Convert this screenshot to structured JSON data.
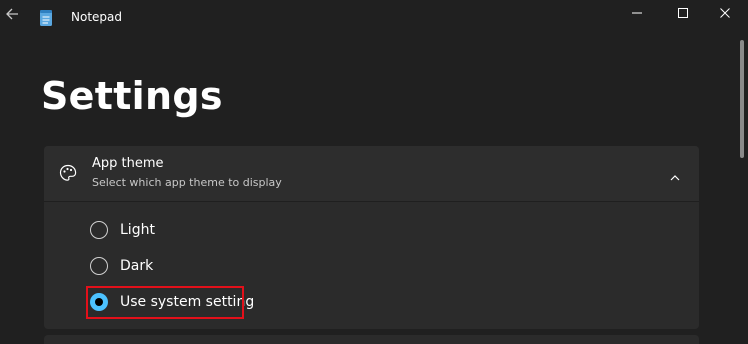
{
  "window": {
    "app_title": "Notepad",
    "controls": [
      "minimize",
      "maximize",
      "close"
    ]
  },
  "page": {
    "title": "Settings"
  },
  "app_theme": {
    "title": "App theme",
    "subtitle": "Select which app theme to display",
    "expanded": true,
    "options": [
      {
        "label": "Light",
        "selected": false
      },
      {
        "label": "Dark",
        "selected": false
      },
      {
        "label": "Use system setting",
        "selected": true
      }
    ]
  },
  "icons": [
    "back-arrow-icon",
    "notepad-icon",
    "palette-icon",
    "chevron-up-icon"
  ],
  "colors": {
    "background": "#202020",
    "card": "#2b2b2b",
    "accent": "#4cc2ff",
    "highlight": "#e3101a"
  }
}
